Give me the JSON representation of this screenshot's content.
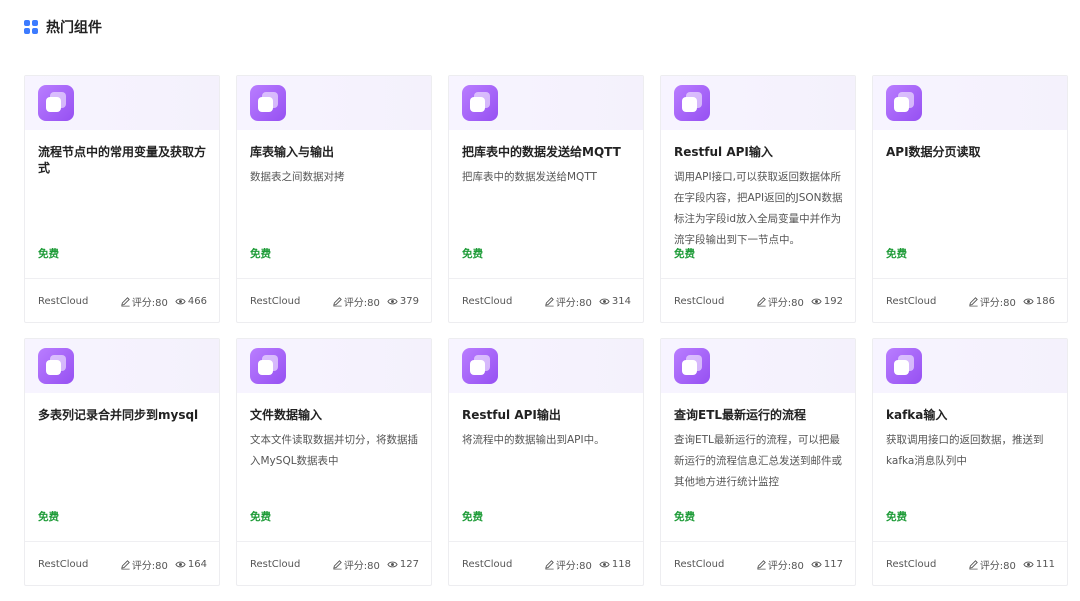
{
  "header": {
    "title": "热门组件",
    "icon": "grid-icon",
    "icon_color": "#3d7bff"
  },
  "theme": {
    "card_icon_gradient": [
      "#b97dff",
      "#9650f2"
    ],
    "price_color": "#1d9b37"
  },
  "cards": [
    {
      "title": "流程节点中的常用变量及获取方式",
      "desc": "",
      "price": "免费",
      "author": "RestCloud",
      "score_label": "评分:80",
      "views": "466"
    },
    {
      "title": "库表输入与输出",
      "desc": "数据表之间数据对拷",
      "price": "免费",
      "author": "RestCloud",
      "score_label": "评分:80",
      "views": "379"
    },
    {
      "title": "把库表中的数据发送给MQTT",
      "desc": "把库表中的数据发送给MQTT",
      "price": "免费",
      "author": "RestCloud",
      "score_label": "评分:80",
      "views": "314"
    },
    {
      "title": "Restful API输入",
      "desc": "调用API接口,可以获取返回数据体所在字段内容，把API返回的JSON数据标注为字段id放入全局变量中并作为流字段输出到下一节点中。",
      "price": "免费",
      "author": "RestCloud",
      "score_label": "评分:80",
      "views": "192"
    },
    {
      "title": "API数据分页读取",
      "desc": "",
      "price": "免费",
      "author": "RestCloud",
      "score_label": "评分:80",
      "views": "186"
    },
    {
      "title": "多表列记录合并同步到mysql",
      "desc": "",
      "price": "免费",
      "author": "RestCloud",
      "score_label": "评分:80",
      "views": "164"
    },
    {
      "title": "文件数据输入",
      "desc": "文本文件读取数据并切分，将数据插入MySQL数据表中",
      "price": "免费",
      "author": "RestCloud",
      "score_label": "评分:80",
      "views": "127"
    },
    {
      "title": "Restful API输出",
      "desc": "将流程中的数据输出到API中。",
      "price": "免费",
      "author": "RestCloud",
      "score_label": "评分:80",
      "views": "118"
    },
    {
      "title": "查询ETL最新运行的流程",
      "desc": "查询ETL最新运行的流程，可以把最新运行的流程信息汇总发送到邮件或其他地方进行统计监控",
      "price": "免费",
      "author": "RestCloud",
      "score_label": "评分:80",
      "views": "117"
    },
    {
      "title": "kafka输入",
      "desc": "获取调用接口的返回数据，推送到kafka消息队列中",
      "price": "免费",
      "author": "RestCloud",
      "score_label": "评分:80",
      "views": "111"
    }
  ]
}
